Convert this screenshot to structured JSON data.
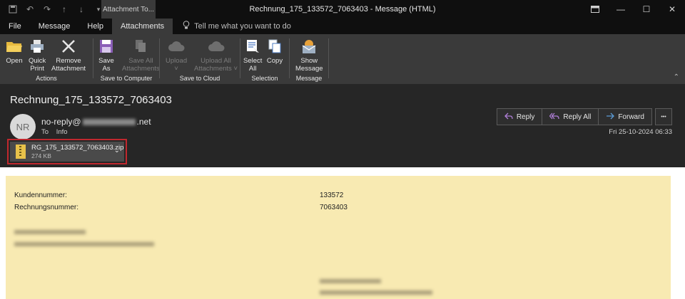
{
  "window": {
    "context_tab": "Attachment To...",
    "title": "Rechnung_175_133572_7063403  -  Message (HTML)"
  },
  "tabs": [
    {
      "label": "File"
    },
    {
      "label": "Message"
    },
    {
      "label": "Help"
    },
    {
      "label": "Attachments"
    }
  ],
  "tellme": "Tell me what you want to do",
  "ribbon": {
    "groups": [
      {
        "label": "Actions"
      },
      {
        "label": "Save to Computer"
      },
      {
        "label": "Save to Cloud"
      },
      {
        "label": "Selection"
      },
      {
        "label": "Message"
      }
    ],
    "buttons": {
      "open": "Open",
      "quick_print_1": "Quick",
      "quick_print_2": "Print",
      "remove_1": "Remove",
      "remove_2": "Attachment",
      "save_as_1": "Save",
      "save_as_2": "As",
      "save_all_1": "Save All",
      "save_all_2": "Attachments",
      "upload_1": "Upload",
      "upload_2": "˅",
      "upload_all_1": "Upload All",
      "upload_all_2": "Attachments ˅",
      "select_all_1": "Select",
      "select_all_2": "All",
      "copy": "Copy",
      "show_message_1": "Show",
      "show_message_2": "Message"
    }
  },
  "message": {
    "subject": "Rechnung_175_133572_7063403",
    "avatar_initials": "NR",
    "sender_prefix": "no-reply@",
    "sender_suffix": ".net",
    "to_label": "To",
    "to_value": "Info",
    "reply": "Reply",
    "reply_all": "Reply All",
    "forward": "Forward",
    "more": "•••",
    "date": "Fri 25-10-2024 06:33",
    "attachment": {
      "name": "RG_175_133572_7063403.zip",
      "size": "274 KB"
    }
  },
  "body": {
    "customer_label": "Kundennummer:",
    "customer_value": "133572",
    "invoice_label": "Rechnungsnummer:",
    "invoice_value": "7063403"
  },
  "colors": {
    "accent_attachment_border": "#c0282e",
    "letter_background": "#f8eab2"
  }
}
